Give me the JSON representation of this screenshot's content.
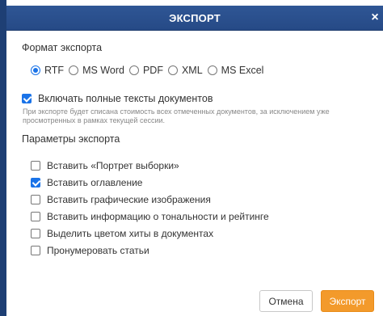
{
  "dialog": {
    "title": "ЭКСПОРТ",
    "close_glyph": "×"
  },
  "format": {
    "heading": "Формат экспорта",
    "options": [
      {
        "label": "RTF",
        "selected": true
      },
      {
        "label": "MS Word",
        "selected": false
      },
      {
        "label": "PDF",
        "selected": false
      },
      {
        "label": "XML",
        "selected": false
      },
      {
        "label": "MS Excel",
        "selected": false
      }
    ]
  },
  "include_full_texts": {
    "label": "Включать полные тексты документов",
    "checked": true,
    "note": "При экспорте будет списана стоимость всех отмеченных документов, за исключением уже просмотренных в рамках текущей сессии."
  },
  "params": {
    "heading": "Параметры экспорта",
    "items": [
      {
        "label": "Вставить «Портрет выборки»",
        "checked": false
      },
      {
        "label": "Вставить оглавление",
        "checked": true
      },
      {
        "label": "Вставить графические изображения",
        "checked": false
      },
      {
        "label": "Вставить информацию о тональности и рейтинге",
        "checked": false
      },
      {
        "label": "Выделить цветом хиты в документах",
        "checked": false
      },
      {
        "label": "Пронумеровать статьи",
        "checked": false
      }
    ]
  },
  "buttons": {
    "cancel": "Отмена",
    "export": "Экспорт"
  },
  "colors": {
    "header": "#2a4f8c",
    "accent": "#1a73e8",
    "export_button": "#f39a2b"
  }
}
